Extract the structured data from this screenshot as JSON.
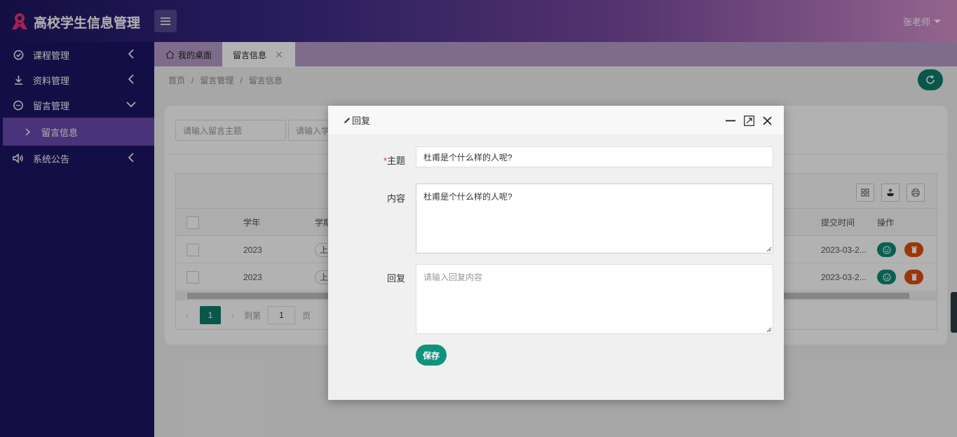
{
  "app": {
    "title": "高校学生信息管理",
    "user": "张老师"
  },
  "sidebar": {
    "items": [
      {
        "label": "课程管理",
        "icon": "check-circle-icon"
      },
      {
        "label": "资料管理",
        "icon": "download-icon"
      },
      {
        "label": "留言管理",
        "icon": "message-icon",
        "expanded": true
      },
      {
        "label": "系统公告",
        "icon": "speaker-icon"
      }
    ],
    "sub_items": [
      {
        "label": "留言信息",
        "active": true
      }
    ]
  },
  "tabs": [
    {
      "label": "我的桌面",
      "icon": "home-icon"
    },
    {
      "label": "留言信息",
      "active": true
    }
  ],
  "breadcrumb": [
    "首页",
    "留言管理",
    "留言信息"
  ],
  "search": {
    "subject_placeholder": "请输入留言主题",
    "second_placeholder": "请输入学"
  },
  "table": {
    "headers": {
      "year": "学年",
      "term": "学期",
      "submit_time": "提交时间",
      "actions": "操作"
    },
    "rows": [
      {
        "year": "2023",
        "term": "上",
        "submit_time": "2023-03-2..."
      },
      {
        "year": "2023",
        "term": "上",
        "submit_time": "2023-03-2..."
      }
    ]
  },
  "pager": {
    "current_page": "1",
    "goto_label": "到第",
    "goto_value": "1",
    "page_suffix": "页"
  },
  "dialog": {
    "title": "回复",
    "fields": {
      "subject_label": "主题",
      "subject_required_mark": "*",
      "subject_value": "杜甫是个什么样的人呢?",
      "content_label": "内容",
      "content_value": "杜甫是个什么样的人呢?",
      "reply_label": "回复",
      "reply_placeholder": "请输入回复内容"
    },
    "save_label": "保存"
  },
  "colors": {
    "sidebar_bg": "#1e1565",
    "sidebar_active": "#6a4ab0",
    "primary_teal": "#0d7d6c",
    "danger_orange": "#e04e0d",
    "brand_pink": "#e8317a"
  }
}
